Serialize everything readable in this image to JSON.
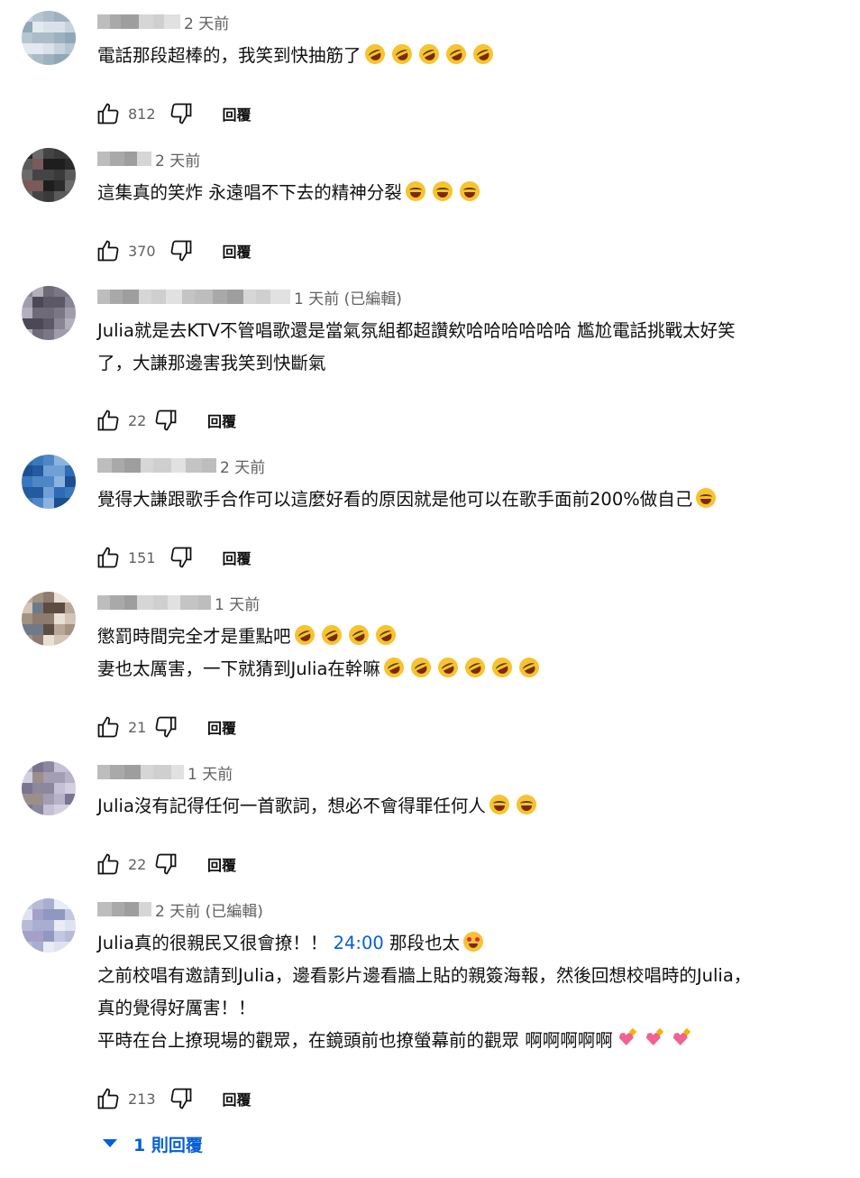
{
  "comments": [
    {
      "author": "",
      "time": "2 天前",
      "lines": [
        "電話那段超棒的，我笑到快抽筋了"
      ],
      "emoji_lines": [
        [
          "rofl",
          "rofl",
          "rofl",
          "rofl",
          "rofl"
        ]
      ],
      "likes": "812",
      "reply_label": "回覆"
    },
    {
      "author": "",
      "time": "2 天前",
      "lines": [
        "這集真的笑炸 永遠唱不下去的精神分裂"
      ],
      "emoji_lines": [
        [
          "joy",
          "joy",
          "joy"
        ]
      ],
      "likes": "370",
      "reply_label": "回覆"
    },
    {
      "author": "",
      "time": "1 天前 (已編輯)",
      "lines": [
        "Julia就是去KTV不管唱歌還是當氣氛組都超讚欸哈哈哈哈哈哈 尷尬電話挑戰太好笑",
        "了，大謙那邊害我笑到快斷氣"
      ],
      "likes": "22",
      "reply_label": "回覆"
    },
    {
      "author": "",
      "time": "2 天前",
      "lines": [
        "覺得大謙跟歌手合作可以這麼好看的原因就是他可以在歌手面前200%做自己"
      ],
      "emoji_lines": [
        [
          "joy"
        ]
      ],
      "likes": "151",
      "reply_label": "回覆"
    },
    {
      "author": "",
      "time": "1 天前",
      "lines": [
        "懲罰時間完全才是重點吧",
        "妻也太厲害，一下就猜到Julia在幹嘛"
      ],
      "emoji_lines": [
        [
          "rofl",
          "rofl",
          "rofl",
          "rofl"
        ],
        [
          "rofl",
          "rofl",
          "rofl",
          "rofl",
          "rofl",
          "rofl"
        ]
      ],
      "likes": "21",
      "reply_label": "回覆"
    },
    {
      "author": "",
      "time": "1 天前",
      "lines": [
        "Julia沒有記得任何一首歌詞，想必不會得罪任何人"
      ],
      "emoji_lines": [
        [
          "joy",
          "joy"
        ]
      ],
      "likes": "22",
      "reply_label": "回覆"
    },
    {
      "author": "",
      "time": "2 天前 (已編輯)",
      "line1_a": "Julia真的很親民又很會撩！！",
      "timestamp_link": "24:00",
      "line1_b": "那段也太",
      "lines_rest": [
        "之前校唱有邀請到Julia，邊看影片邊看牆上貼的親簽海報，然後回想校唱時的Julia，",
        "真的覺得好厲害！！",
        "平時在台上撩現場的觀眾，在鏡頭前也撩螢幕前的觀眾 啊啊啊啊啊"
      ],
      "likes": "213",
      "reply_label": "回覆",
      "replies_toggle": "1 則回覆"
    }
  ],
  "icons": {
    "like": "thumb-up-icon",
    "dislike": "thumb-down-icon",
    "expand": "caret-down-icon"
  },
  "colors": {
    "link": "#065fd4",
    "meta": "#606060",
    "text": "#0f0f0f"
  }
}
